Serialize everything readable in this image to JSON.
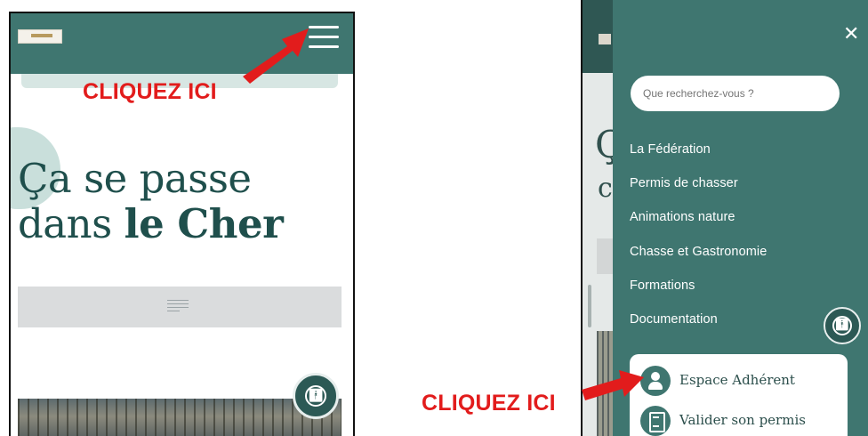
{
  "annotation": {
    "left_label": "CLIQUEZ ICI",
    "right_label": "CLIQUEZ ICI",
    "arrow_color": "#e21c1c"
  },
  "mobile_home": {
    "header_color": "#3f7670",
    "menu_icon": "hamburger-icon",
    "hero_line1": "Ça se passe",
    "hero_line2_prefix": "dans",
    "hero_line2_bold": "le Cher",
    "accessibility_icon": "accessibility-icon"
  },
  "mobile_menu": {
    "close_label": "✕",
    "search_placeholder": "Que recherchez-vous ?",
    "items": [
      {
        "label": "La Fédération"
      },
      {
        "label": "Permis de chasser"
      },
      {
        "label": "Animations nature"
      },
      {
        "label": "Chasse et Gastronomie"
      },
      {
        "label": "Formations"
      },
      {
        "label": "Documentation"
      }
    ],
    "member_links": [
      {
        "label": "Espace Adhérent",
        "icon": "user-icon"
      },
      {
        "label": "Valider son permis",
        "icon": "document-icon"
      }
    ],
    "background_letters": [
      "Ç",
      "c"
    ]
  }
}
